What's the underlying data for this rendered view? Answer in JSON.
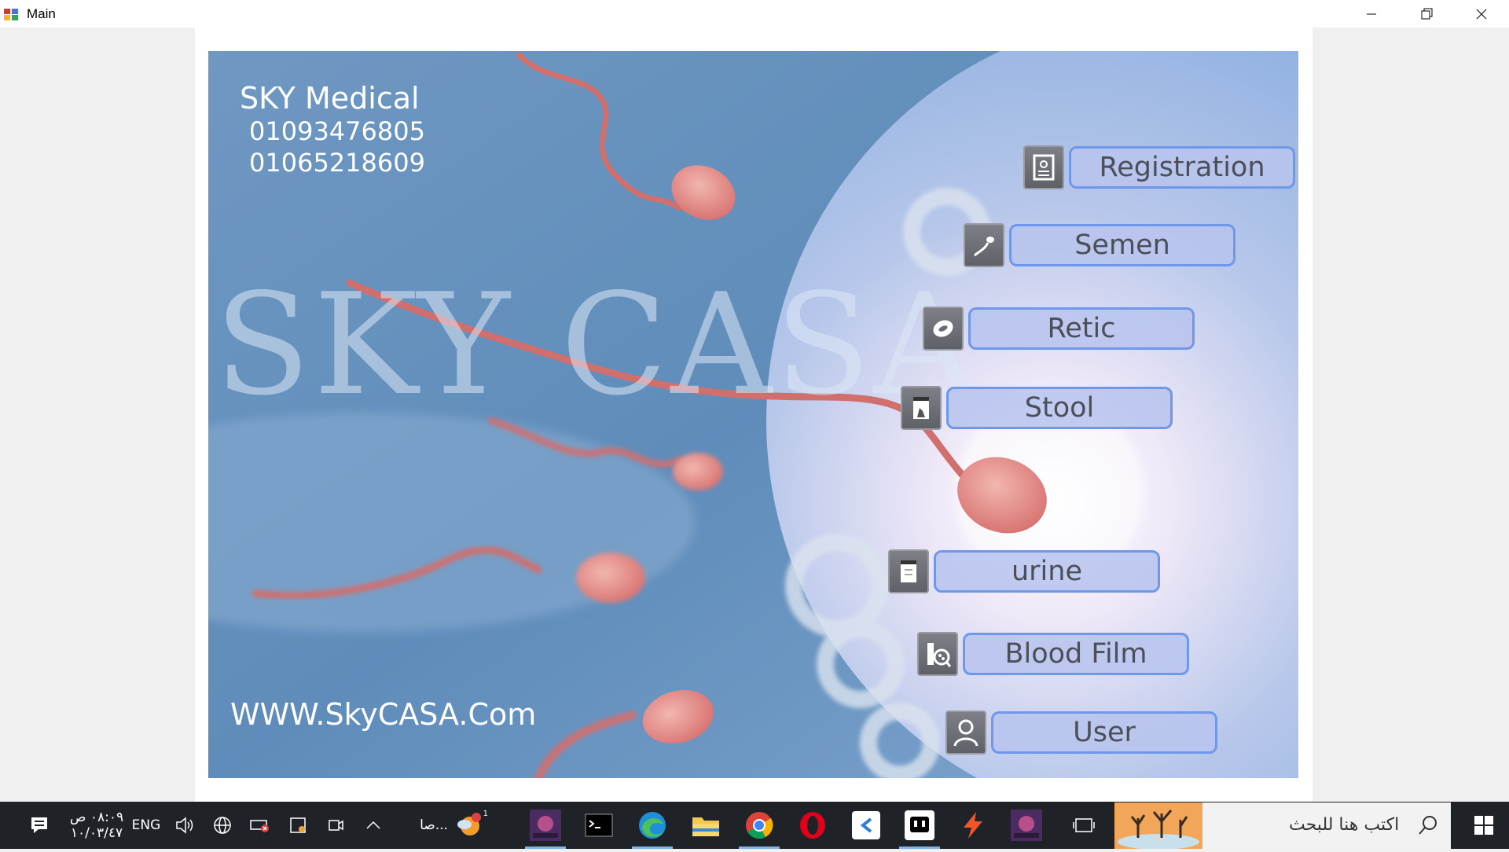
{
  "window": {
    "title": "Main"
  },
  "brand": {
    "name": "SKY Medical",
    "phone1": "01093476805",
    "phone2": "01065218609",
    "watermark": "SKY CASA",
    "website": "WWW.SkyCASA.Com"
  },
  "menu": {
    "registration": "Registration",
    "semen": "Semen",
    "retic": "Retic",
    "stool": "Stool",
    "urine": "urine",
    "blood_film": "Blood Film",
    "user": "User"
  },
  "taskbar": {
    "search_placeholder": "اكتب هنا للبحث",
    "clock_time": "٠٨:٠٩ ص",
    "clock_date": "١٠/٠٣/٤٧",
    "language": "ENG",
    "weather_label": "صا...",
    "weather_badge": "1"
  },
  "colors": {
    "button_fill": "#b8c4ee",
    "button_border": "#6f97ea",
    "background_blue": "#6d96bd",
    "taskbar": "#1f2328"
  }
}
